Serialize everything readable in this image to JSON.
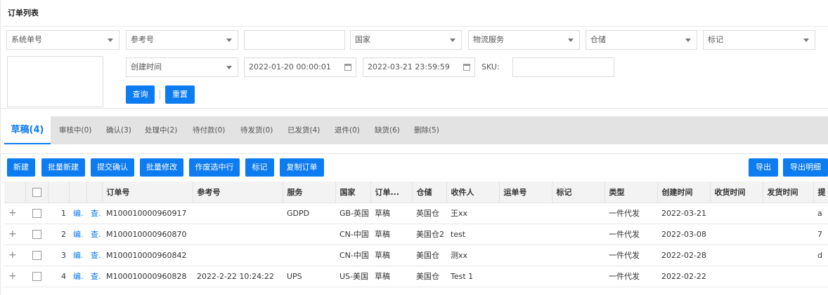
{
  "title": "订单列表",
  "filters": {
    "system_no": "系统单号",
    "ref_no": "参考号",
    "keyword_value": "",
    "country": "国家",
    "logistics": "物流服务",
    "warehouse": "仓储",
    "mark": "标记",
    "time_type": "创建时间",
    "start_time": "2022-01-20 00:00:01",
    "end_time": "2022-03-21 23:59:59",
    "sku_label": "SKU:",
    "sku_value": "",
    "search_button": "查询",
    "reset_button": "重置"
  },
  "tabs": [
    {
      "label": "草稿(4)",
      "active": true
    },
    {
      "label": "审核中(0)"
    },
    {
      "label": "确认(3)"
    },
    {
      "label": "处理中(2)"
    },
    {
      "label": "待付款(0)"
    },
    {
      "label": "待发货(0)"
    },
    {
      "label": "已发货(4)"
    },
    {
      "label": "退件(0)"
    },
    {
      "label": "缺货(6)"
    },
    {
      "label": "删除(5)"
    }
  ],
  "actions": {
    "new": "新建",
    "batch_new": "批量新建",
    "submit_confirm": "提交确认",
    "batch_edit": "批量修改",
    "void_selected": "作废选中行",
    "mark": "标记",
    "copy_order": "复制订单",
    "export": "导出",
    "export_detail": "导出明细"
  },
  "table": {
    "headers": [
      "订单号",
      "参考号",
      "服务",
      "国家",
      "订单...",
      "仓储",
      "收件人",
      "运单号",
      "标记",
      "类型",
      "创建时间",
      "收货时间",
      "发货时间",
      "提"
    ],
    "edit_label": "编.",
    "view_label": "查.",
    "rows": [
      {
        "idx": "1",
        "order_no": "M100010000960917",
        "ref": "",
        "service": "GDPD",
        "country": "GB-英国",
        "status": "草稿",
        "warehouse": "英国仓",
        "receiver": "王xx",
        "waybill": "",
        "mark": "",
        "type": "一件代发",
        "created": "2022-03-21",
        "received": "",
        "shipped": "",
        "extra": "a"
      },
      {
        "idx": "2",
        "order_no": "M100010000960870",
        "ref": "",
        "service": "",
        "country": "CN-中国",
        "status": "草稿",
        "warehouse": "美国仓2",
        "receiver": "test",
        "waybill": "",
        "mark": "",
        "type": "一件代发",
        "created": "2022-03-08",
        "received": "",
        "shipped": "",
        "extra": "7"
      },
      {
        "idx": "3",
        "order_no": "M100010000960842",
        "ref": "",
        "service": "",
        "country": "CN-中国",
        "status": "草稿",
        "warehouse": "美国仓",
        "receiver": "测xx",
        "waybill": "",
        "mark": "",
        "type": "一件代发",
        "created": "2022-02-28",
        "received": "",
        "shipped": "",
        "extra": "d"
      },
      {
        "idx": "4",
        "order_no": "M100010000960828",
        "ref": "2022-2-22 10:24:22",
        "service": "UPS",
        "country": "US-美国",
        "status": "草稿",
        "warehouse": "美国仓",
        "receiver": "Test 1",
        "waybill": "",
        "mark": "",
        "type": "一件代发",
        "created": "2022-02-22",
        "received": "",
        "shipped": "",
        "extra": ""
      }
    ]
  }
}
